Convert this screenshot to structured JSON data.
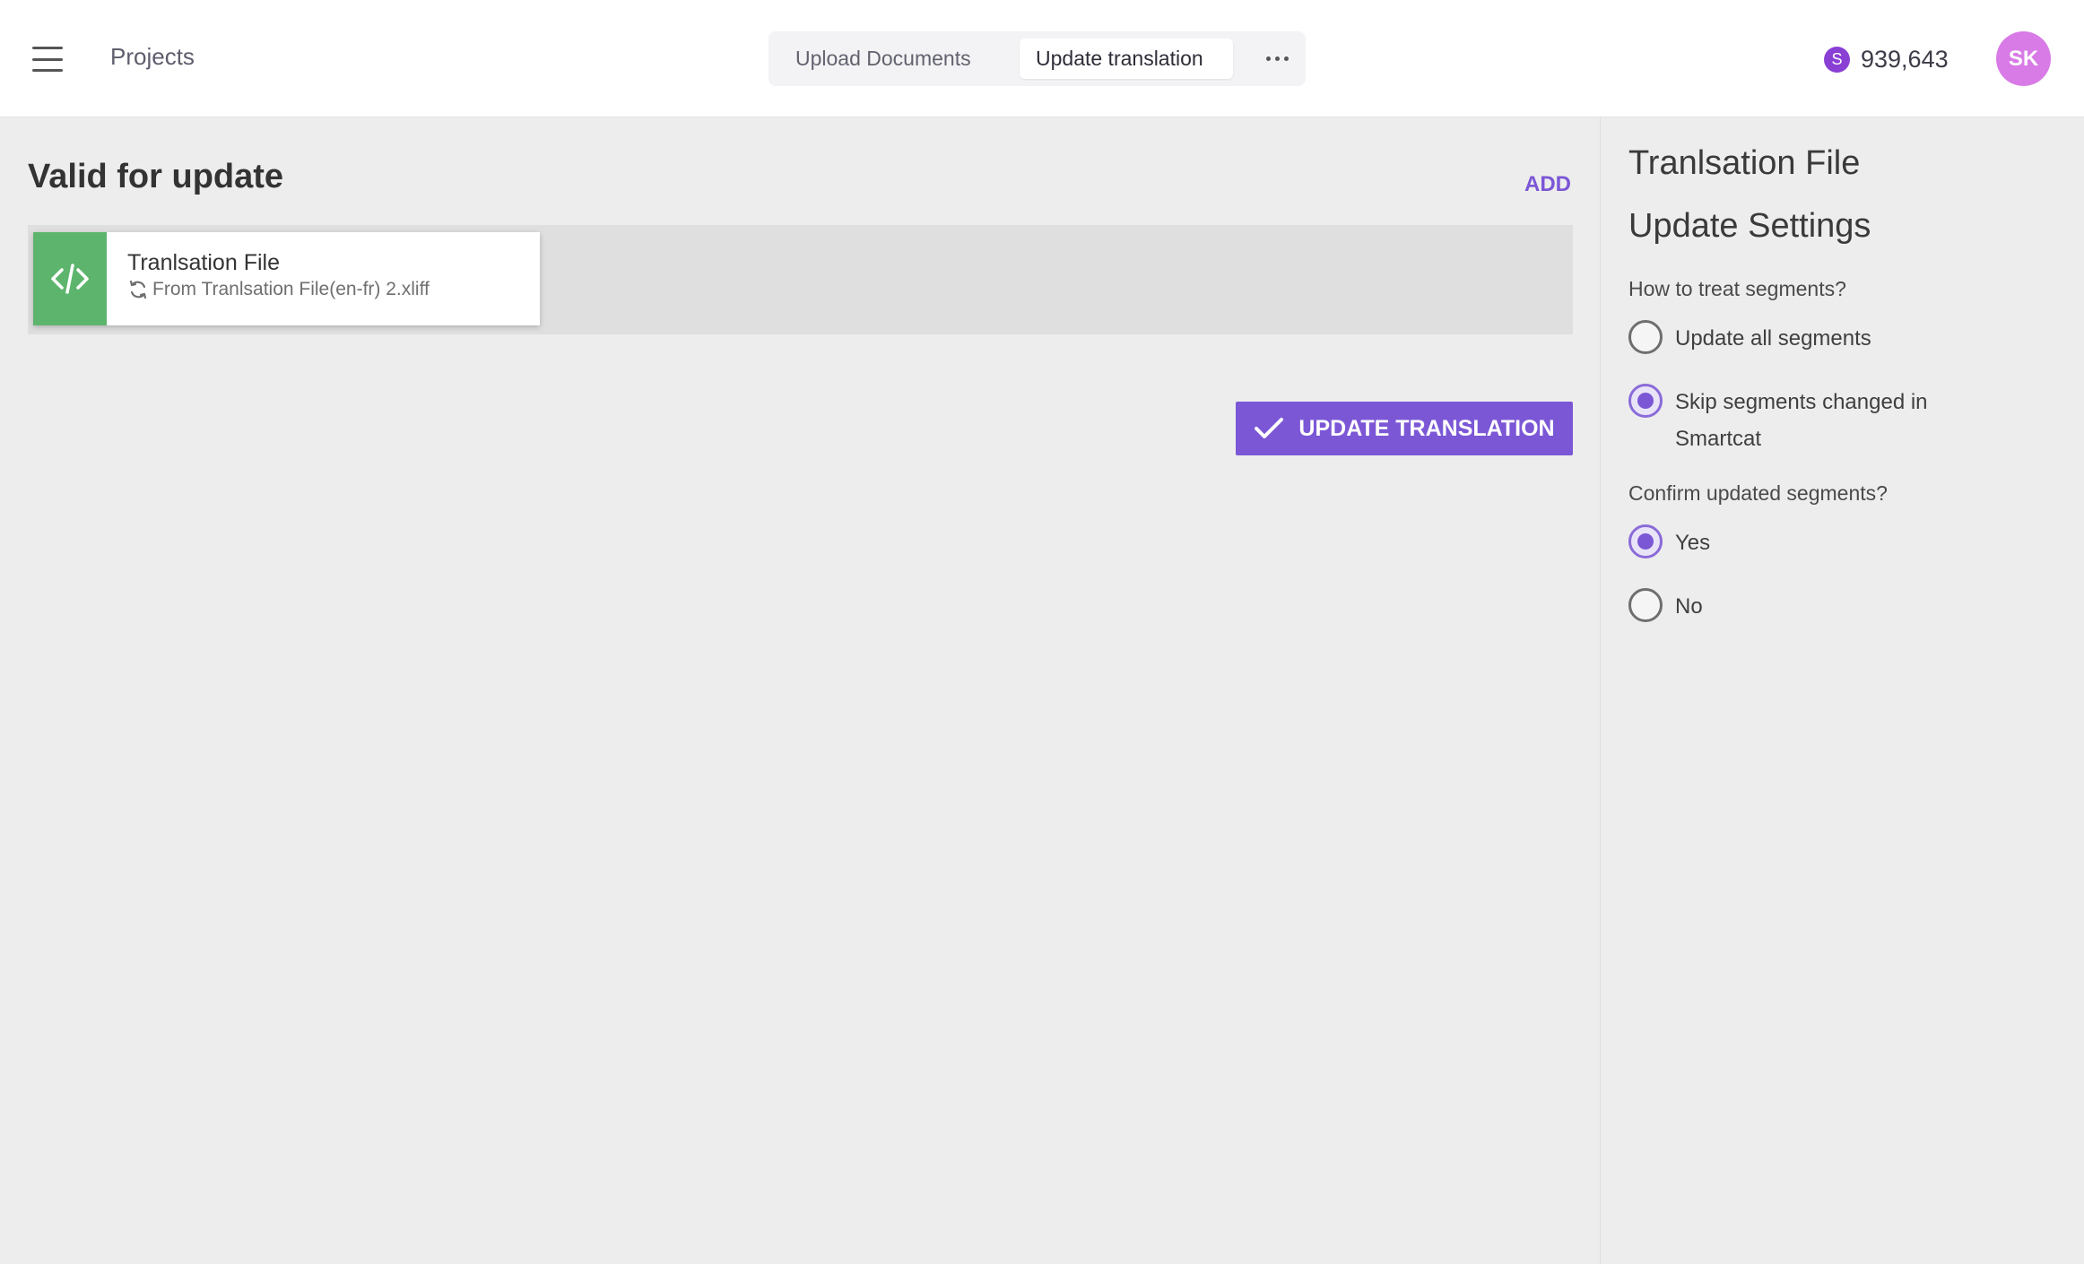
{
  "header": {
    "projects_label": "Projects",
    "tabs": [
      {
        "label": "Upload Documents",
        "active": false
      },
      {
        "label": "Update translation",
        "active": true
      }
    ],
    "more_icon": "more-horizontal-icon",
    "balance": {
      "currency_symbol": "S",
      "amount": "939,643"
    },
    "avatar_initials": "SK"
  },
  "main": {
    "section_title": "Valid for update",
    "add_label": "ADD",
    "files": [
      {
        "name": "Tranlsation File",
        "source": "From Tranlsation File(en-fr) 2.xliff",
        "icon": "code-icon"
      }
    ],
    "update_button_label": "UPDATE TRANSLATION"
  },
  "panel": {
    "title_line1": "Tranlsation File",
    "title_line2": "Update Settings",
    "segments_question": "How to treat segments?",
    "segments_options": [
      {
        "label": "Update all segments",
        "checked": false
      },
      {
        "label_line1": "Skip segments changed in",
        "label_line2": "Smartcat",
        "checked": true
      }
    ],
    "confirm_question": "Confirm updated segments?",
    "confirm_options": [
      {
        "label": "Yes",
        "checked": true
      },
      {
        "label": "No",
        "checked": false
      }
    ]
  },
  "colors": {
    "accent": "#7b57d6",
    "file_icon_bg": "#5db56d",
    "avatar_bg": "#d87be6",
    "coin_bg": "#8a3fd4"
  }
}
